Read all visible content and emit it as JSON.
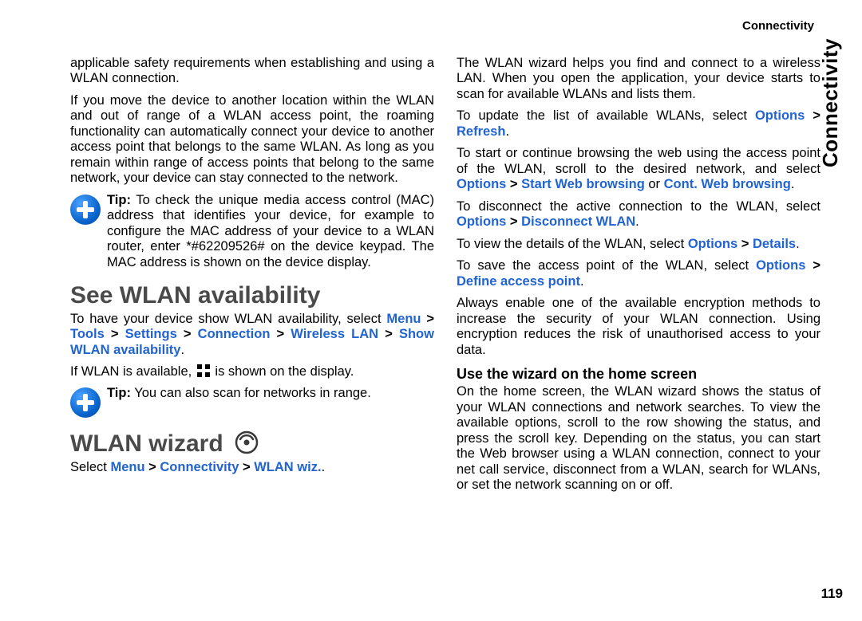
{
  "running_header": "Connectivity",
  "side_tab": "Connectivity",
  "page_number": "119",
  "left": {
    "p1": "applicable safety requirements when establishing and using a WLAN connection.",
    "p2": "If you move the device to another location within the WLAN and out of range of a WLAN access point, the roaming functionality can automatically connect your device to another access point that belongs to the same WLAN. As long as you remain within range of access points that belong to the same network, your device can stay connected to the network.",
    "tip1_label": "Tip:",
    "tip1_text": "To check the unique media access control (MAC) address that identifies your device, for example to configure the MAC address of your device to a WLAN router, enter *#62209526# on the device keypad. The MAC address is shown on the device display.",
    "h_see": "See WLAN availability",
    "see_p1_a": "To have your device show WLAN availability, select ",
    "nav_menu": "Menu",
    "nav_tools": "Tools",
    "nav_settings": "Settings",
    "nav_connection": "Connection",
    "nav_wlan": "Wireless LAN",
    "nav_show": "Show WLAN availability",
    "see_p2_a": "If WLAN is available, ",
    "see_p2_b": " is shown on the display.",
    "tip2_label": "Tip:",
    "tip2_text": "You can also scan for networks in range.",
    "h_wizard": "WLAN wizard",
    "wiz_p1_a": "Select ",
    "wiz_nav_menu": "Menu",
    "wiz_nav_conn": "Connectivity",
    "wiz_nav_wiz": "WLAN wiz.",
    "wiz_p1_b": "."
  },
  "right": {
    "p1": "The WLAN wizard helps you find and connect to a wireless LAN. When you open the application, your device starts to scan for available WLANs and lists them.",
    "p2_a": "To update the list of available WLANs, select ",
    "opt": "Options",
    "refresh": "Refresh",
    "p3_a": "To start or continue browsing the web using the access point of the WLAN, scroll to the desired network, and select ",
    "startweb": "Start Web browsing",
    "p3_or": " or ",
    "contweb": "Cont. Web browsing",
    "p4_a": "To disconnect the active connection to the WLAN, select ",
    "disconnect": "Disconnect WLAN",
    "p5_a": "To view the details of the WLAN, select ",
    "details": "Details",
    "p6_a": "To save the access point of the WLAN, select ",
    "define": "Define access point",
    "p7": "Always enable one of the available encryption methods to increase the security of your WLAN connection. Using encryption reduces the risk of unauthorised access to your data.",
    "h_use": "Use the wizard on the home screen",
    "p8": "On the home screen, the WLAN wizard shows the status of your WLAN connections and network searches. To view the available options, scroll to the row showing the status, and press the scroll key. Depending on the status, you can start the Web browser using a WLAN connection, connect to your net call service, disconnect from a WLAN, search for WLANs, or set the network scanning on or off."
  }
}
